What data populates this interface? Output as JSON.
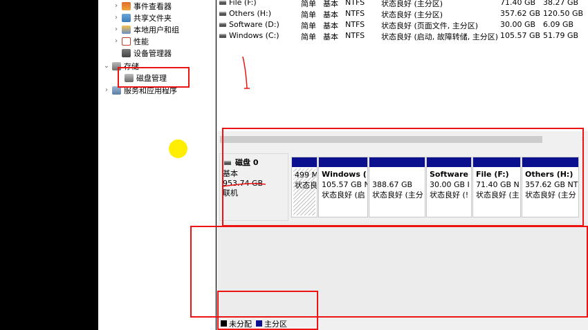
{
  "sidebar": {
    "items": [
      {
        "label": "事件查看器",
        "icon": "event-viewer-icon",
        "expanded": false
      },
      {
        "label": "共享文件夹",
        "icon": "shared-folder-icon",
        "expanded": false
      },
      {
        "label": "本地用户和组",
        "icon": "local-users-icon",
        "expanded": false
      },
      {
        "label": "性能",
        "icon": "performance-icon",
        "expanded": false
      },
      {
        "label": "设备管理器",
        "icon": "device-manager-icon"
      },
      {
        "label": "存储",
        "icon": "storage-icon",
        "expanded": true
      },
      {
        "label": "磁盘管理",
        "icon": "disk-management-icon",
        "selected": true
      },
      {
        "label": "服务和应用程序",
        "icon": "services-apps-icon",
        "expanded": false
      }
    ]
  },
  "volumes": [
    {
      "name": "File (F:)",
      "layout": "简单",
      "type": "基本",
      "fs": "NTFS",
      "status": "状态良好 (主分区)",
      "capacity": "71.40 GB",
      "free": "38.27 GB"
    },
    {
      "name": "Others (H:)",
      "layout": "简单",
      "type": "基本",
      "fs": "NTFS",
      "status": "状态良好 (主分区)",
      "capacity": "357.62 GB",
      "free": "120.50 GB"
    },
    {
      "name": "Software (D:)",
      "layout": "简单",
      "type": "基本",
      "fs": "NTFS",
      "status": "状态良好 (页面文件, 主分区)",
      "capacity": "30.00 GB",
      "free": "6.09 GB"
    },
    {
      "name": "Windows (C:)",
      "layout": "简单",
      "type": "基本",
      "fs": "NTFS",
      "status": "状态良好 (启动, 故障转储, 主分区)",
      "capacity": "105.57 GB",
      "free": "51.79 GB"
    }
  ],
  "disk": {
    "name": "磁盘 0",
    "type": "基本",
    "size": "953.74 GB",
    "state": "联机",
    "partitions": [
      {
        "name": "",
        "size": "499 M",
        "status": "状态良",
        "kind": "unallocated"
      },
      {
        "name": "Windows (",
        "size": "105.57 GB N",
        "status": "状态良好 (启",
        "kind": "primary"
      },
      {
        "name": "",
        "size": "388.67 GB",
        "status": "状态良好 (主分",
        "kind": "primary"
      },
      {
        "name": "Software",
        "size": "30.00 GB I",
        "status": "状态良好 (!",
        "kind": "primary"
      },
      {
        "name": "File  (F:)",
        "size": "71.40 GB N",
        "status": "状态良好 (主",
        "kind": "primary"
      },
      {
        "name": "Others  (H:)",
        "size": "357.62 GB NT",
        "status": "状态良好 (主分",
        "kind": "primary"
      }
    ]
  },
  "legend": {
    "unallocated_label": "未分配",
    "primary_label": "主分区",
    "unallocated_color": "#000000",
    "primary_color": "#0b108f"
  },
  "colors": {
    "partition_bar": "#0b108f",
    "annotation_red": "#e11111",
    "cursor_highlight": "#ffee00"
  }
}
